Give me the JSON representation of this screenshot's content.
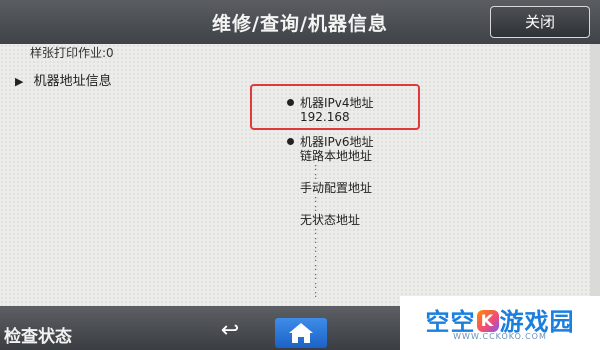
{
  "header": {
    "title": "维修/查询/机器信息",
    "close_label": "关闭"
  },
  "content": {
    "prev_line": "样张打印作业:0",
    "section_label": "机器地址信息",
    "ipv4": {
      "label": "机器IPv4地址",
      "value": "192.168"
    },
    "ipv6": {
      "label": "机器IPv6地址",
      "link_local_label": "链路本地地址",
      "manual_label": "手动配置地址",
      "stateless_label": "无状态地址"
    }
  },
  "bottom": {
    "status_label": "检查状态",
    "back_icon": "back-arrow-icon",
    "home_icon": "home-icon"
  },
  "brand": {
    "name_left": "空空",
    "name_right": "游戏园",
    "url": "WWW.CCKOKO.COM"
  },
  "colors": {
    "highlight": "#e0393b",
    "home_button": "#2a74d8",
    "brand_blue": "#1b7fe0"
  }
}
